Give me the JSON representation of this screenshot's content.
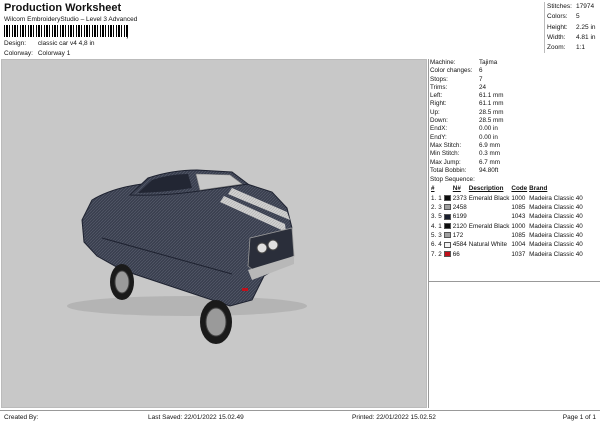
{
  "header": {
    "title": "Production Worksheet",
    "subtitle": "Wilcom EmbroideryStudio – Level 3 Advanced",
    "barcode_suffix": ",",
    "design_label": "Design:",
    "design_value": "classic car v4 4,8 in",
    "colorway_label": "Colorway:",
    "colorway_value": "Colorway 1"
  },
  "stats": [
    {
      "label": "Stitches:",
      "value": "17974"
    },
    {
      "label": "Colors:",
      "value": "5"
    },
    {
      "label": "Height:",
      "value": "2.25 in"
    },
    {
      "label": "Width:",
      "value": "4.81 in"
    },
    {
      "label": "Zoom:",
      "value": "1:1"
    }
  ],
  "machine_info": [
    {
      "label": "Machine:",
      "value": "Tajima"
    },
    {
      "label": "Color changes:",
      "value": "6"
    },
    {
      "label": "Stops:",
      "value": "7"
    },
    {
      "label": "Trims:",
      "value": "24"
    },
    {
      "label": "Left:",
      "value": "61.1 mm"
    },
    {
      "label": "Right:",
      "value": "61.1 mm"
    },
    {
      "label": "Up:",
      "value": "28.5 mm"
    },
    {
      "label": "Down:",
      "value": "28.5 mm"
    },
    {
      "label": "EndX:",
      "value": "0.00 in"
    },
    {
      "label": "EndY:",
      "value": "0.00 in"
    },
    {
      "label": "Max Stitch:",
      "value": "6.9 mm"
    },
    {
      "label": "Min Stitch:",
      "value": "0.3 mm"
    },
    {
      "label": "Max Jump:",
      "value": "6.7 mm"
    },
    {
      "label": "Total Bobbin:",
      "value": "94.80ft"
    }
  ],
  "stop_sequence": {
    "title": "Stop Sequence:",
    "headers": [
      "#",
      "N#",
      "Description",
      "Code",
      "Brand"
    ],
    "rows": [
      {
        "stop": "1.",
        "color": "1",
        "swatch": "#0d0d0d",
        "n": "2373",
        "desc": "Emerald Black",
        "code": "1000",
        "brand": "Madeira Classic 40"
      },
      {
        "stop": "2.",
        "color": "3",
        "swatch": "#a0a0a0",
        "n": "2458",
        "desc": "",
        "code": "1085",
        "brand": "Madeira Classic 40"
      },
      {
        "stop": "3.",
        "color": "5",
        "swatch": "#1a1f2e",
        "n": "6199",
        "desc": "",
        "code": "1043",
        "brand": "Madeira Classic 40"
      },
      {
        "stop": "4.",
        "color": "1",
        "swatch": "#0d0d0d",
        "n": "2120",
        "desc": "Emerald Black",
        "code": "1000",
        "brand": "Madeira Classic 40"
      },
      {
        "stop": "5.",
        "color": "3",
        "swatch": "#a0a0a0",
        "n": "172",
        "desc": "",
        "code": "1085",
        "brand": "Madeira Classic 40"
      },
      {
        "stop": "6.",
        "color": "4",
        "swatch": "#f2f2f2",
        "n": "4584",
        "desc": "Natural White",
        "code": "1004",
        "brand": "Madeira Classic 40"
      },
      {
        "stop": "7.",
        "color": "2",
        "swatch": "#c0101a",
        "n": "66",
        "desc": "",
        "code": "1037",
        "brand": "Madeira Classic 40"
      }
    ]
  },
  "footer": {
    "created_by": "Created By:",
    "last_saved": "Last Saved: 22/01/2022 15.02.49",
    "printed": "Printed: 22/01/2022 15.02.52",
    "page": "Page 1 of 1"
  },
  "colors": {
    "canvas_bg": "#c8c8c8",
    "car_body": "#3a3f4f",
    "stripe": "#d8d8d8"
  }
}
